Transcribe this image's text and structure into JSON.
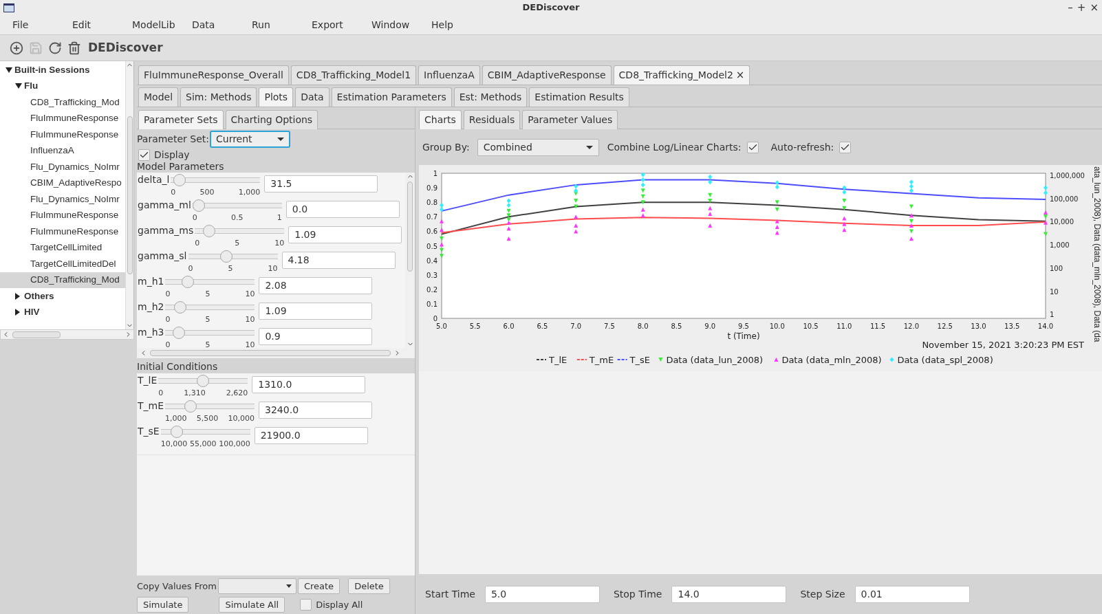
{
  "window": {
    "title": "DEDiscover",
    "controls": [
      "–",
      "+",
      "×"
    ]
  },
  "menu": [
    "File",
    "Edit",
    "ModelLib",
    "Data",
    "Run",
    "Export",
    "Window",
    "Help"
  ],
  "toolbar": {
    "title": "DEDiscover",
    "buttons": [
      {
        "kind": "add",
        "disabled": false
      },
      {
        "kind": "save",
        "disabled": true
      },
      {
        "kind": "refresh",
        "disabled": false
      },
      {
        "kind": "delete",
        "disabled": false
      }
    ]
  },
  "tree": [
    {
      "label": "Built-in Sessions",
      "expanded": true,
      "selected": false,
      "children": [
        {
          "label": "Flu",
          "expanded": true,
          "selected": false,
          "children": [
            {
              "label": "CD8_Trafficking_Mod",
              "selected": false
            },
            {
              "label": "FluImmuneResponse",
              "selected": false
            },
            {
              "label": "FluImmuneResponse",
              "selected": false
            },
            {
              "label": "InfluenzaA",
              "selected": false
            },
            {
              "label": "Flu_Dynamics_NoImr",
              "selected": false
            },
            {
              "label": "CBIM_AdaptiveRespo",
              "selected": false
            },
            {
              "label": "Flu_Dynamics_NoImr",
              "selected": false
            },
            {
              "label": "FluImmuneResponse",
              "selected": false
            },
            {
              "label": "FluImmuneResponse",
              "selected": false
            },
            {
              "label": "TargetCellLimited",
              "selected": false
            },
            {
              "label": "TargetCellLimitedDel",
              "selected": false
            },
            {
              "label": "CD8_Trafficking_Mod",
              "selected": true
            }
          ]
        },
        {
          "label": "Others",
          "expanded": false,
          "selected": false
        },
        {
          "label": "HIV",
          "expanded": false,
          "selected": false
        }
      ]
    }
  ],
  "session_tabs": [
    {
      "label": "FluImmuneResponse_Overall",
      "selected": false
    },
    {
      "label": "CD8_Trafficking_Model1",
      "selected": false
    },
    {
      "label": "InfluenzaA",
      "selected": false
    },
    {
      "label": "CBIM_AdaptiveResponse",
      "selected": false
    },
    {
      "label": "CD8_Trafficking_Model2",
      "selected": true,
      "close": "×"
    }
  ],
  "view_tabs": [
    {
      "label": "Model",
      "selected": false
    },
    {
      "label": "Sim: Methods",
      "selected": false
    },
    {
      "label": "Plots",
      "selected": true
    },
    {
      "label": "Data",
      "selected": false
    },
    {
      "label": "Estimation Parameters",
      "selected": false
    },
    {
      "label": "Est: Methods",
      "selected": false
    },
    {
      "label": "Estimation Results",
      "selected": false
    }
  ],
  "left_tabs": [
    {
      "label": "Parameter Sets",
      "selected": true
    },
    {
      "label": "Charting Options",
      "selected": false
    }
  ],
  "parameter_set": {
    "label": "Parameter Set:",
    "value": "Current"
  },
  "display": {
    "label": "Display",
    "checked": true
  },
  "model_parameters": {
    "title": "Model Parameters",
    "items": [
      {
        "name": "delta_l",
        "level": 0.0315,
        "ticks": [
          "0",
          "500",
          "1,000"
        ],
        "value": "31.5"
      },
      {
        "name": "gamma_ml",
        "level": 0,
        "ticks": [
          "0",
          "0.5",
          "1"
        ],
        "value": "0.0"
      },
      {
        "name": "gamma_ms",
        "level": 0.109,
        "ticks": [
          "0",
          "5",
          "10"
        ],
        "value": "1.09"
      },
      {
        "name": "gamma_sl",
        "level": 0.418,
        "ticks": [
          "0",
          "5",
          "10"
        ],
        "value": "4.18"
      },
      {
        "name": "m_h1",
        "level": 0.208,
        "ticks": [
          "0",
          "5",
          "10"
        ],
        "value": "2.08"
      },
      {
        "name": "m_h2",
        "level": 0.109,
        "ticks": [
          "0",
          "5",
          "10"
        ],
        "value": "1.09"
      },
      {
        "name": "m_h3",
        "level": 0.09,
        "ticks": [
          "0",
          "5",
          "10"
        ],
        "value": "0.9"
      }
    ]
  },
  "initial_conditions": {
    "title": "Initial Conditions",
    "items": [
      {
        "name": "T_lE",
        "level": 0.5,
        "ticks": [
          "0",
          "1,310",
          "2,620"
        ],
        "value": "1310.0"
      },
      {
        "name": "T_mE",
        "level": 0.249,
        "ticks": [
          "1,000",
          "5,500",
          "10,000"
        ],
        "value": "3240.0"
      },
      {
        "name": "T_sE",
        "level": 0.132,
        "ticks": [
          "10,000",
          "55,000",
          "100,000"
        ],
        "value": "21900.0"
      }
    ]
  },
  "copy_values": {
    "label": "Copy Values From",
    "create": "Create",
    "delete": "Delete"
  },
  "run_buttons": {
    "simulate": "Simulate",
    "simulate_all": "Simulate All",
    "display_all": {
      "label": "Display All",
      "checked": false
    }
  },
  "right_tabs": [
    {
      "label": "Charts",
      "selected": true
    },
    {
      "label": "Residuals",
      "selected": false
    },
    {
      "label": "Parameter Values",
      "selected": false
    }
  ],
  "group_by": {
    "label": "Group By:",
    "value": "Combined"
  },
  "combine": {
    "label": "Combine Log/Linear Charts:",
    "checked": true
  },
  "auto_refresh": {
    "label": "Auto-refresh:",
    "checked": true
  },
  "chart": {
    "timestamp": "November 15, 2021 3:20:23 PM EST",
    "right_axis": {
      "label": "ata_lun_2008), Data (data_mln_2008), Data (da",
      "ticks": [
        "1,000,000",
        "100,000",
        "10,000",
        "1,000",
        "100",
        "10",
        "1"
      ]
    },
    "chart_data": {
      "type": "line",
      "xlabel": "t (Time)",
      "xlim": [
        5,
        14
      ],
      "ylim": [
        0,
        1
      ],
      "legend": true,
      "xticks": [
        {
          "value": 5,
          "label": "5.0"
        },
        5.5,
        {
          "value": 6,
          "label": "6.0"
        },
        6.5,
        {
          "value": 7,
          "label": "7.0"
        },
        7.5,
        {
          "value": 8,
          "label": "8.0"
        },
        8.5,
        {
          "value": 9,
          "label": "9.0"
        },
        9.5,
        {
          "value": 10,
          "label": "10.0"
        },
        10.5,
        {
          "value": 11,
          "label": "11.0"
        },
        11.5,
        {
          "value": 12,
          "label": "12.0"
        },
        12.5,
        {
          "value": 13,
          "label": "13.0"
        },
        13.5,
        {
          "value": 14,
          "label": "14.0"
        }
      ],
      "yticks": [
        0,
        0.1,
        0.2,
        0.3,
        0.4,
        0.5,
        0.6,
        0.7,
        0.8,
        0.9,
        1
      ],
      "x": [
        5,
        6,
        7,
        8,
        9,
        10,
        11,
        12,
        13,
        14
      ],
      "series": [
        {
          "name": "T_lE",
          "color": "#404040",
          "values": [
            0.58,
            0.7,
            0.77,
            0.8,
            0.8,
            0.78,
            0.75,
            0.71,
            0.68,
            0.67
          ]
        },
        {
          "name": "T_mE",
          "color": "#ff4d4d",
          "values": [
            0.59,
            0.65,
            0.685,
            0.695,
            0.69,
            0.675,
            0.655,
            0.64,
            0.64,
            0.665
          ]
        },
        {
          "name": "T_sE",
          "color": "#4d4dff",
          "values": [
            0.74,
            0.85,
            0.92,
            0.955,
            0.955,
            0.93,
            0.89,
            0.86,
            0.83,
            0.82
          ]
        },
        {
          "name": "Data (data_lun_2008)",
          "type": "scatter",
          "marker": "triangle-down",
          "color": "#33ee33",
          "x": [
            5,
            5,
            5,
            6,
            6,
            6,
            7,
            7,
            7,
            8,
            8,
            8,
            9,
            9,
            10,
            10,
            11,
            11,
            12,
            12,
            12,
            14,
            14
          ],
          "values": [
            0.55,
            0.47,
            0.43,
            0.74,
            0.71,
            0.68,
            0.86,
            0.81,
            0.77,
            0.88,
            0.84,
            0.8,
            0.85,
            0.81,
            0.8,
            0.75,
            0.81,
            0.76,
            0.77,
            0.67,
            0.6,
            0.7,
            0.58
          ]
        },
        {
          "name": "Data (data_mln_2008)",
          "type": "scatter",
          "marker": "triangle-up",
          "color": "#ff33ff",
          "x": [
            5,
            5,
            5,
            6,
            6,
            6,
            7,
            7,
            7,
            8,
            8,
            9,
            9,
            9,
            10,
            10,
            10,
            11,
            11,
            11,
            12,
            12,
            12,
            14,
            14
          ],
          "values": [
            0.67,
            0.61,
            0.51,
            0.66,
            0.62,
            0.55,
            0.7,
            0.64,
            0.6,
            0.75,
            0.71,
            0.76,
            0.72,
            0.64,
            0.67,
            0.63,
            0.59,
            0.69,
            0.65,
            0.61,
            0.71,
            0.64,
            0.55,
            0.73,
            0.66
          ]
        },
        {
          "name": "Data (data_spl_2008)",
          "type": "scatter",
          "marker": "diamond",
          "color": "#33eeff",
          "x": [
            5,
            5,
            6,
            6,
            7,
            7,
            8,
            8,
            8,
            9,
            9,
            10,
            10,
            11,
            11,
            12,
            12,
            12,
            14,
            14
          ],
          "values": [
            0.78,
            0.75,
            0.81,
            0.78,
            0.91,
            0.88,
            0.99,
            0.955,
            0.92,
            0.975,
            0.94,
            0.935,
            0.905,
            0.9,
            0.87,
            0.94,
            0.91,
            0.88,
            0.9,
            0.865
          ]
        }
      ]
    }
  },
  "time_fields": [
    {
      "label": "Start Time",
      "value": "5.0"
    },
    {
      "label": "Stop Time",
      "value": "14.0"
    },
    {
      "label": "Step Size",
      "value": "0.01"
    }
  ]
}
